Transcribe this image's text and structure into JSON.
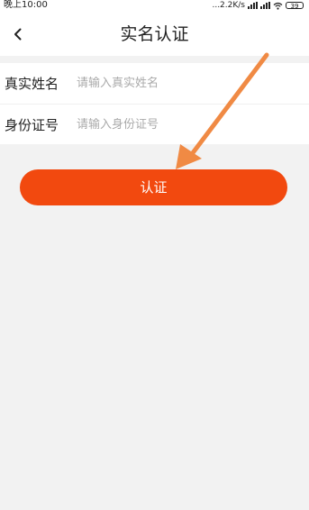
{
  "status_bar": {
    "time": "晚上10:00",
    "network_speed": "...2.2K/s",
    "battery": "39"
  },
  "header": {
    "title": "实名认证",
    "back_icon": "chevron-left-icon"
  },
  "form": {
    "fields": [
      {
        "label": "真实姓名",
        "placeholder": "请输入真实姓名",
        "value": ""
      },
      {
        "label": "身份证号",
        "placeholder": "请输入身份证号",
        "value": ""
      }
    ]
  },
  "actions": {
    "confirm_label": "认证"
  },
  "colors": {
    "accent": "#f2490f",
    "arrow": "#f08a44"
  }
}
